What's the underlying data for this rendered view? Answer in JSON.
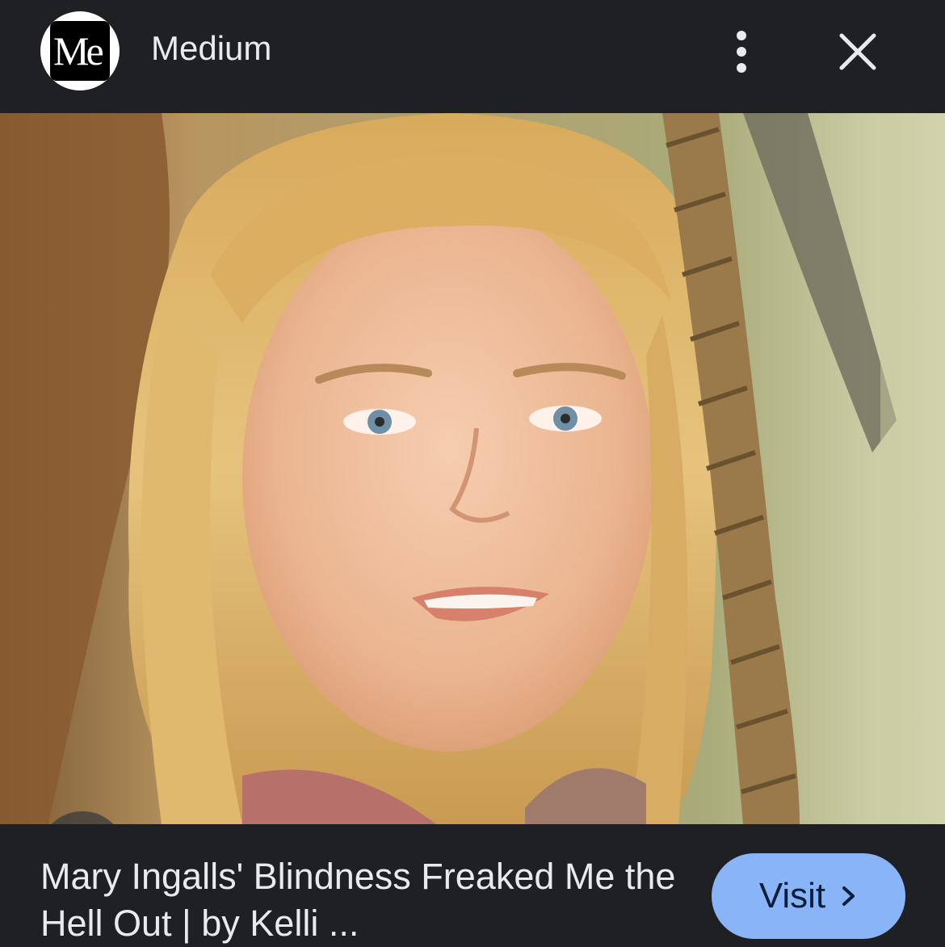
{
  "header": {
    "logo_text": "Me",
    "site_name": "Medium",
    "more_icon": "more-vert-icon",
    "close_icon": "close-icon"
  },
  "image": {
    "description_icon": "lens-search-icon"
  },
  "result": {
    "title": "Mary Ingalls' Blindness Freaked Me the Hell Out | by Kelli ...",
    "visit_label": "Visit",
    "visit_icon": "chevron-right-icon"
  },
  "colors": {
    "background": "#1f2023",
    "visit_button": "#8ab4f8",
    "text": "#e8eaed"
  }
}
